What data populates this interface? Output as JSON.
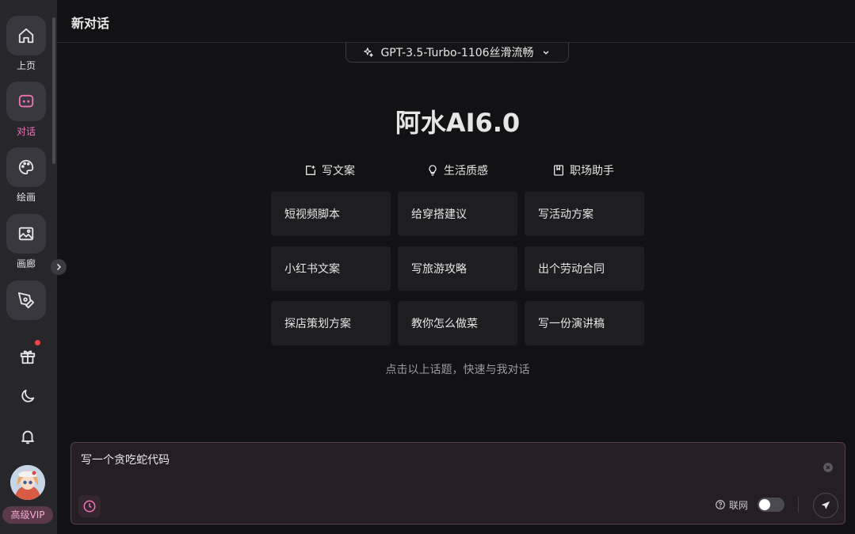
{
  "header": {
    "title": "新对话"
  },
  "model": {
    "name": "GPT-3.5-Turbo-1106丝滑流畅"
  },
  "sidebar": {
    "items": [
      {
        "label": "上页",
        "icon": "home-icon"
      },
      {
        "label": "对话",
        "icon": "chat-icon",
        "active": true
      },
      {
        "label": "绘画",
        "icon": "palette-icon"
      },
      {
        "label": "画廊",
        "icon": "gallery-icon"
      },
      {
        "label": "",
        "icon": "pen-tool-icon"
      }
    ],
    "vip": "高级VIP",
    "accent": "#f472b6"
  },
  "main": {
    "brand": "阿水AI6.0",
    "categories": [
      {
        "label": "写文案",
        "icon": "edit-icon"
      },
      {
        "label": "生活质感",
        "icon": "bulb-icon"
      },
      {
        "label": "职场助手",
        "icon": "book-icon"
      }
    ],
    "cards": [
      "短视频脚本",
      "给穿搭建议",
      "写活动方案",
      "小红书文案",
      "写旅游攻略",
      "出个劳动合同",
      "探店策划方案",
      "教你怎么做菜",
      "写一份演讲稿"
    ],
    "hint": "点击以上话题，快速与我对话"
  },
  "composer": {
    "value": "写一个贪吃蛇代码",
    "web_label": "联网",
    "web_enabled": false
  }
}
